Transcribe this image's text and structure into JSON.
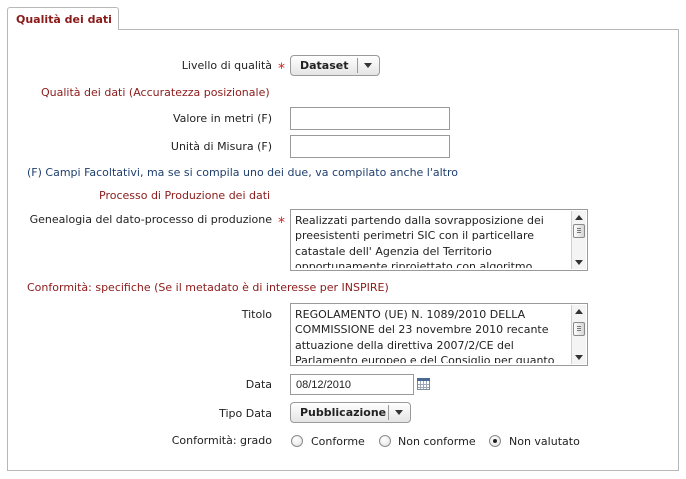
{
  "tab": {
    "label": "Qualità dei dati"
  },
  "livello": {
    "label": "Livello di qualità",
    "value": "Dataset"
  },
  "accuratezza_title": "Qualità dei dati (Accuratezza posizionale)",
  "valore": {
    "label": "Valore in metri (F)",
    "value": ""
  },
  "unita": {
    "label": "Unità di Misura (F)",
    "value": ""
  },
  "note_facoltativi": "(F) Campi Facoltativi, ma se si compila uno dei due, va compilato anche l'altro",
  "processo_title": "Processo di Produzione dei dati",
  "genealogia": {
    "label": "Genealogia del dato-processo di produzione",
    "lines": [
      "Realizzati partendo dalla sovrapposizione dei",
      "preesistenti perimetri SIC con il particellare",
      "catastale dell' Agenzia del Territorio",
      "opportunamente riproiettato con algoritmo"
    ]
  },
  "conformita_title": "Conformità: specifiche  (Se il metadato è di interesse per INSPIRE)",
  "titolo": {
    "label": "Titolo",
    "lines": [
      "REGOLAMENTO (UE) N. 1089/2010 DELLA",
      "COMMISSIONE del 23 novembre 2010 recante",
      "attuazione della direttiva 2007/2/CE del",
      "Parlamento europeo e del Consiglio per quanto"
    ]
  },
  "data": {
    "label": "Data",
    "value": "08/12/2010"
  },
  "tipo_data": {
    "label": "Tipo Data",
    "value": "Pubblicazione"
  },
  "grado": {
    "label": "Conformità: grado",
    "options": [
      "Conforme",
      "Non conforme",
      "Non valutato"
    ],
    "selected": "Non valutato"
  },
  "colors": {
    "maroon": "#8b1a1a",
    "blue": "#1f3f6e",
    "required": "#cc2222"
  }
}
